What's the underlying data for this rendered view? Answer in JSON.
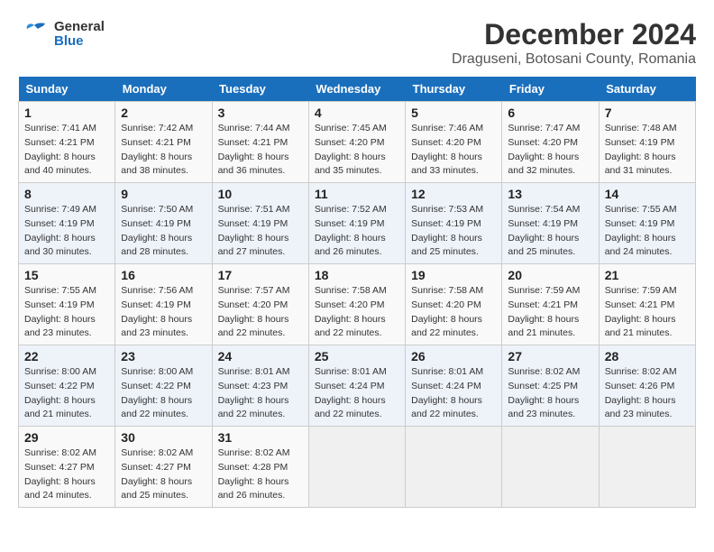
{
  "logo": {
    "text_general": "General",
    "text_blue": "Blue"
  },
  "title": "December 2024",
  "subtitle": "Draguseni, Botosani County, Romania",
  "days_of_week": [
    "Sunday",
    "Monday",
    "Tuesday",
    "Wednesday",
    "Thursday",
    "Friday",
    "Saturday"
  ],
  "weeks": [
    [
      {
        "day": "1",
        "sunrise": "7:41 AM",
        "sunset": "4:21 PM",
        "daylight": "8 hours and 40 minutes."
      },
      {
        "day": "2",
        "sunrise": "7:42 AM",
        "sunset": "4:21 PM",
        "daylight": "8 hours and 38 minutes."
      },
      {
        "day": "3",
        "sunrise": "7:44 AM",
        "sunset": "4:21 PM",
        "daylight": "8 hours and 36 minutes."
      },
      {
        "day": "4",
        "sunrise": "7:45 AM",
        "sunset": "4:20 PM",
        "daylight": "8 hours and 35 minutes."
      },
      {
        "day": "5",
        "sunrise": "7:46 AM",
        "sunset": "4:20 PM",
        "daylight": "8 hours and 33 minutes."
      },
      {
        "day": "6",
        "sunrise": "7:47 AM",
        "sunset": "4:20 PM",
        "daylight": "8 hours and 32 minutes."
      },
      {
        "day": "7",
        "sunrise": "7:48 AM",
        "sunset": "4:19 PM",
        "daylight": "8 hours and 31 minutes."
      }
    ],
    [
      {
        "day": "8",
        "sunrise": "7:49 AM",
        "sunset": "4:19 PM",
        "daylight": "8 hours and 30 minutes."
      },
      {
        "day": "9",
        "sunrise": "7:50 AM",
        "sunset": "4:19 PM",
        "daylight": "8 hours and 28 minutes."
      },
      {
        "day": "10",
        "sunrise": "7:51 AM",
        "sunset": "4:19 PM",
        "daylight": "8 hours and 27 minutes."
      },
      {
        "day": "11",
        "sunrise": "7:52 AM",
        "sunset": "4:19 PM",
        "daylight": "8 hours and 26 minutes."
      },
      {
        "day": "12",
        "sunrise": "7:53 AM",
        "sunset": "4:19 PM",
        "daylight": "8 hours and 25 minutes."
      },
      {
        "day": "13",
        "sunrise": "7:54 AM",
        "sunset": "4:19 PM",
        "daylight": "8 hours and 25 minutes."
      },
      {
        "day": "14",
        "sunrise": "7:55 AM",
        "sunset": "4:19 PM",
        "daylight": "8 hours and 24 minutes."
      }
    ],
    [
      {
        "day": "15",
        "sunrise": "7:55 AM",
        "sunset": "4:19 PM",
        "daylight": "8 hours and 23 minutes."
      },
      {
        "day": "16",
        "sunrise": "7:56 AM",
        "sunset": "4:19 PM",
        "daylight": "8 hours and 23 minutes."
      },
      {
        "day": "17",
        "sunrise": "7:57 AM",
        "sunset": "4:20 PM",
        "daylight": "8 hours and 22 minutes."
      },
      {
        "day": "18",
        "sunrise": "7:58 AM",
        "sunset": "4:20 PM",
        "daylight": "8 hours and 22 minutes."
      },
      {
        "day": "19",
        "sunrise": "7:58 AM",
        "sunset": "4:20 PM",
        "daylight": "8 hours and 22 minutes."
      },
      {
        "day": "20",
        "sunrise": "7:59 AM",
        "sunset": "4:21 PM",
        "daylight": "8 hours and 21 minutes."
      },
      {
        "day": "21",
        "sunrise": "7:59 AM",
        "sunset": "4:21 PM",
        "daylight": "8 hours and 21 minutes."
      }
    ],
    [
      {
        "day": "22",
        "sunrise": "8:00 AM",
        "sunset": "4:22 PM",
        "daylight": "8 hours and 21 minutes."
      },
      {
        "day": "23",
        "sunrise": "8:00 AM",
        "sunset": "4:22 PM",
        "daylight": "8 hours and 22 minutes."
      },
      {
        "day": "24",
        "sunrise": "8:01 AM",
        "sunset": "4:23 PM",
        "daylight": "8 hours and 22 minutes."
      },
      {
        "day": "25",
        "sunrise": "8:01 AM",
        "sunset": "4:24 PM",
        "daylight": "8 hours and 22 minutes."
      },
      {
        "day": "26",
        "sunrise": "8:01 AM",
        "sunset": "4:24 PM",
        "daylight": "8 hours and 22 minutes."
      },
      {
        "day": "27",
        "sunrise": "8:02 AM",
        "sunset": "4:25 PM",
        "daylight": "8 hours and 23 minutes."
      },
      {
        "day": "28",
        "sunrise": "8:02 AM",
        "sunset": "4:26 PM",
        "daylight": "8 hours and 23 minutes."
      }
    ],
    [
      {
        "day": "29",
        "sunrise": "8:02 AM",
        "sunset": "4:27 PM",
        "daylight": "8 hours and 24 minutes."
      },
      {
        "day": "30",
        "sunrise": "8:02 AM",
        "sunset": "4:27 PM",
        "daylight": "8 hours and 25 minutes."
      },
      {
        "day": "31",
        "sunrise": "8:02 AM",
        "sunset": "4:28 PM",
        "daylight": "8 hours and 26 minutes."
      },
      null,
      null,
      null,
      null
    ]
  ]
}
